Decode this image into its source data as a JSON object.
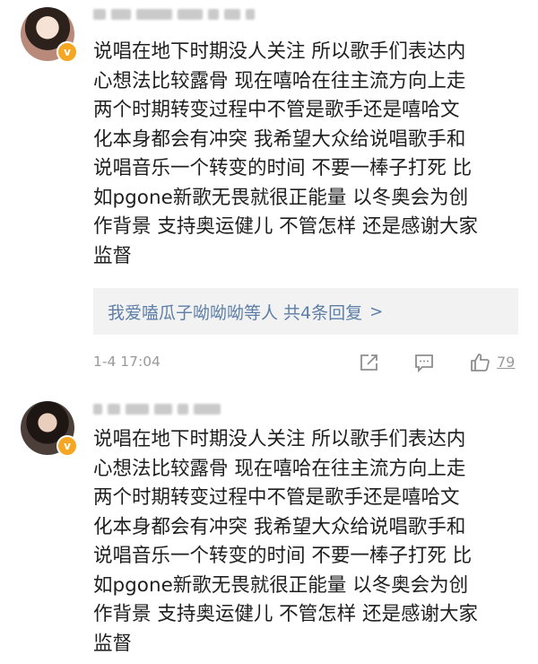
{
  "comments": [
    {
      "body": "说唱在地下时期没人关注 所以歌手们表达内\n心想法比较露骨 现在嘻哈在往主流方向上走\n两个时期转变过程中不管是歌手还是嘻哈文\n化本身都会有冲突 我希望大众给说唱歌手和\n说唱音乐一个转变的时间 不要一棒子打死 比\n如pgone新歌无畏就很正能量 以冬奥会为创\n作背景 支持奥运健儿 不管怎样 还是感谢大家\n监督",
      "replies_label": "我爱嗑瓜子呦呦呦等人 共4条回复",
      "replies_arrow": ">",
      "time": "1-4 17:04",
      "likes": "79"
    },
    {
      "body": "说唱在地下时期没人关注 所以歌手们表达内\n心想法比较露骨 现在嘻哈在往主流方向上走\n两个时期转变过程中不管是歌手还是嘻哈文\n化本身都会有冲突 我希望大众给说唱歌手和\n说唱音乐一个转变的时间 不要一棒子打死 比\n如pgone新歌无畏就很正能量 以冬奥会为创\n作背景 支持奥运健儿 不管怎样 还是感谢大家\n监督"
    }
  ],
  "icons": {
    "verified": "v-badge-icon",
    "share": "share-icon",
    "reply": "comment-icon",
    "like": "thumbs-up-icon"
  },
  "colors": {
    "link": "#5d7fa7",
    "badge": "#f5a623",
    "meta": "#9a9a9a"
  }
}
